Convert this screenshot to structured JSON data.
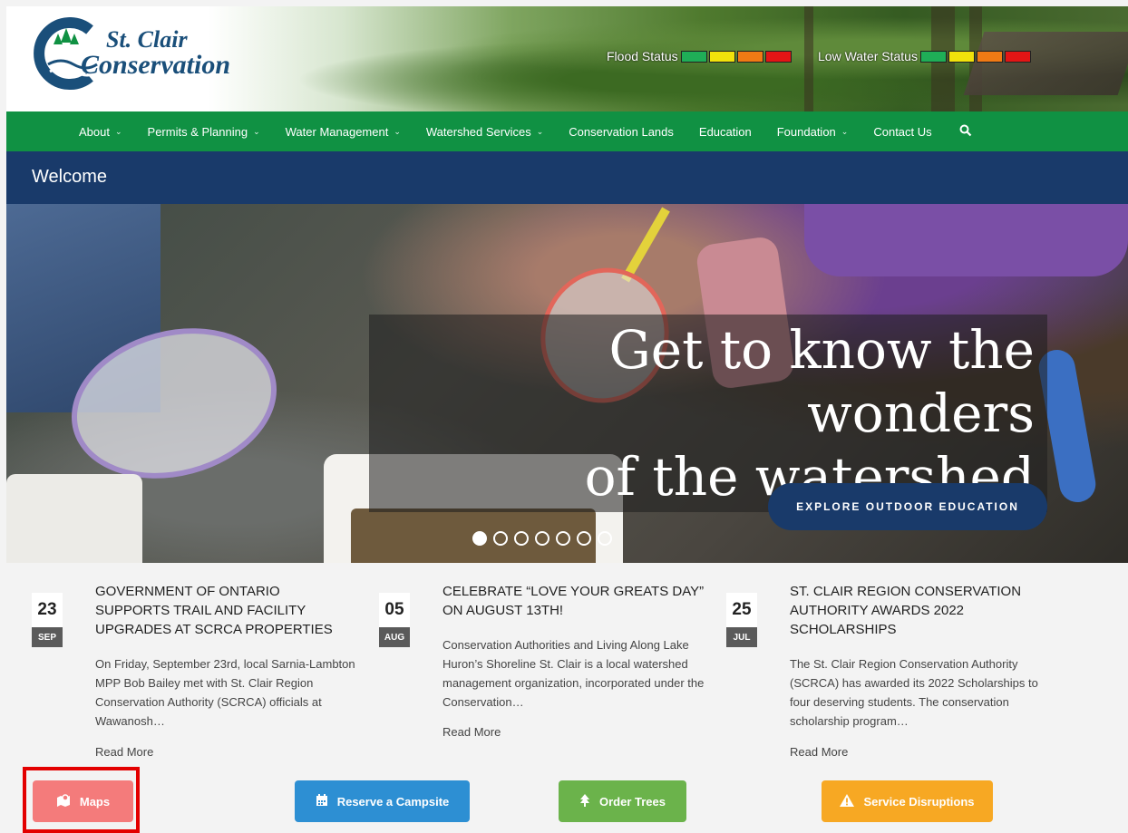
{
  "logo": {
    "line1": "St. Clair",
    "line2": "Conservation"
  },
  "status": {
    "flood_label": "Flood Status",
    "low_water_label": "Low Water Status",
    "colors": [
      "#1fae57",
      "#f1e20b",
      "#f07a14",
      "#e31515"
    ]
  },
  "nav": {
    "items": [
      {
        "label": "About",
        "dropdown": true
      },
      {
        "label": "Permits & Planning",
        "dropdown": true
      },
      {
        "label": "Water Management",
        "dropdown": true
      },
      {
        "label": "Watershed Services",
        "dropdown": true
      },
      {
        "label": "Conservation Lands",
        "dropdown": false
      },
      {
        "label": "Education",
        "dropdown": false
      },
      {
        "label": "Foundation",
        "dropdown": true
      },
      {
        "label": "Contact Us",
        "dropdown": false
      }
    ],
    "search_icon": "search-icon"
  },
  "page": {
    "welcome": "Welcome"
  },
  "hero": {
    "headline_line1": "Get to know the wonders",
    "headline_line2": "of the watershed",
    "cta": "EXPLORE OUTDOOR EDUCATION",
    "slides_total": 7,
    "active_slide": 1
  },
  "news": [
    {
      "day": "23",
      "month": "SEP",
      "title": "GOVERNMENT OF ONTARIO SUPPORTS TRAIL AND FACILITY UPGRADES AT SCRCA PROPERTIES",
      "excerpt": "On Friday, September 23rd, local Sarnia-Lambton MPP Bob Bailey met with St. Clair Region Conservation Authority (SCRCA) officials at Wawanosh…",
      "read_more": "Read More"
    },
    {
      "day": "05",
      "month": "AUG",
      "title": "CELEBRATE “LOVE YOUR GREATS DAY” ON AUGUST 13TH!",
      "excerpt": "Conservation Authorities and Living Along Lake Huron’s Shoreline St. Clair is a local watershed management organization, incorporated under the Conservation…",
      "read_more": "Read More"
    },
    {
      "day": "25",
      "month": "JUL",
      "title": "ST. CLAIR REGION CONSERVATION AUTHORITY AWARDS 2022 SCHOLARSHIPS",
      "excerpt": "The St. Clair Region Conservation Authority (SCRCA) has awarded its 2022 Scholarships to four deserving students. The conservation scholarship program…",
      "read_more": "Read More"
    }
  ],
  "quick_links": [
    {
      "label": "Maps",
      "color": "#f47b7b",
      "icon": "map-icon"
    },
    {
      "label": "Reserve a Campsite",
      "color": "#2d8fd3",
      "icon": "calendar-icon"
    },
    {
      "label": "Order Trees",
      "color": "#6bb34b",
      "icon": "tree-icon"
    },
    {
      "label": "Service Disruptions",
      "color": "#f7a823",
      "icon": "warning-icon"
    }
  ]
}
